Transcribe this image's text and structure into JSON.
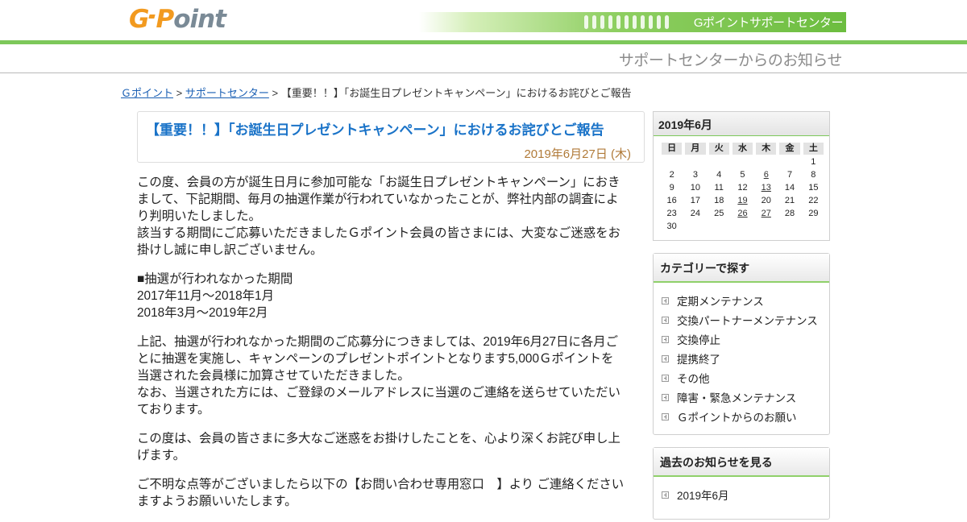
{
  "header": {
    "logo_text": "G-Point",
    "support_center_label": "Gポイントサポートセンター",
    "subbar_title": "サポートセンターからのお知らせ",
    "accent_color": "#7dc85a",
    "logo_orange": "#f29a1f",
    "logo_gray": "#7a8a96"
  },
  "breadcrumb": {
    "items": [
      "Ｇポイント",
      "サポートセンター"
    ],
    "separator": ">",
    "current": "【重要！！】「お誕生日プレゼントキャンペーン」におけるお詫びとご報告"
  },
  "article": {
    "title": "【重要！！】「お誕生日プレゼントキャンペーン」におけるお詫びとご報告",
    "date": "2019年6月27日 (木)",
    "title_color": "#1a73c8",
    "date_color": "#b07a38",
    "paragraphs": [
      [
        "この度、会員の方が誕生日月に参加可能な「お誕生日プレゼントキャンペーン」におき",
        "まして、下記期間、毎月の抽選作業が行われていなかったことが、弊社内部の調査によ",
        "り判明いたしました。",
        "該当する期間にご応募いただきましたＧポイント会員の皆さまには、大変なご迷惑をお",
        "掛けし誠に申し訳ございません。"
      ],
      [
        "■抽選が行われなかった期間",
        "2017年11月～2018年1月",
        "2018年3月～2019年2月"
      ],
      [
        "上記、抽選が行われなかった期間のご応募分につきましては、2019年6月27日に各月ご",
        "とに抽選を実施し、キャンペーンのプレゼントポイントとなります5,000Ｇポイントを",
        "当選された会員様に加算させていただきました。",
        "なお、当選された方には、ご登録のメールアドレスに当選のご連絡を送らせていただい",
        "ております。"
      ],
      [
        "この度は、会員の皆さまに多大なご迷惑をお掛けしたことを、心より深くお詫び申し上",
        "げます。"
      ],
      [
        "ご不明な点等がございましたら以下の【お問い合わせ専用窓口　】より ご連絡ください",
        "ますようお願いいたします。"
      ]
    ]
  },
  "calendar": {
    "title": "2019年6月",
    "weekdays": [
      "日",
      "月",
      "火",
      "水",
      "木",
      "金",
      "土"
    ],
    "weeks": [
      [
        "",
        "",
        "",
        "",
        "",
        "",
        "1"
      ],
      [
        "2",
        "3",
        "4",
        "5",
        "6",
        "7",
        "8"
      ],
      [
        "9",
        "10",
        "11",
        "12",
        "13",
        "14",
        "15"
      ],
      [
        "16",
        "17",
        "18",
        "19",
        "20",
        "21",
        "22"
      ],
      [
        "23",
        "24",
        "25",
        "26",
        "27",
        "28",
        "29"
      ],
      [
        "30",
        "",
        "",
        "",
        "",
        "",
        ""
      ]
    ],
    "linked_days": [
      "6",
      "13",
      "19",
      "26",
      "27"
    ]
  },
  "categories": {
    "title": "カテゴリーで探す",
    "items": [
      "定期メンテナンス",
      "交換パートナーメンテナンス",
      "交換停止",
      "提携終了",
      "その他",
      "障害・緊急メンテナンス",
      "Ｇポイントからのお願い"
    ]
  },
  "archive": {
    "title": "過去のお知らせを見る",
    "items": [
      "2019年6月"
    ]
  }
}
